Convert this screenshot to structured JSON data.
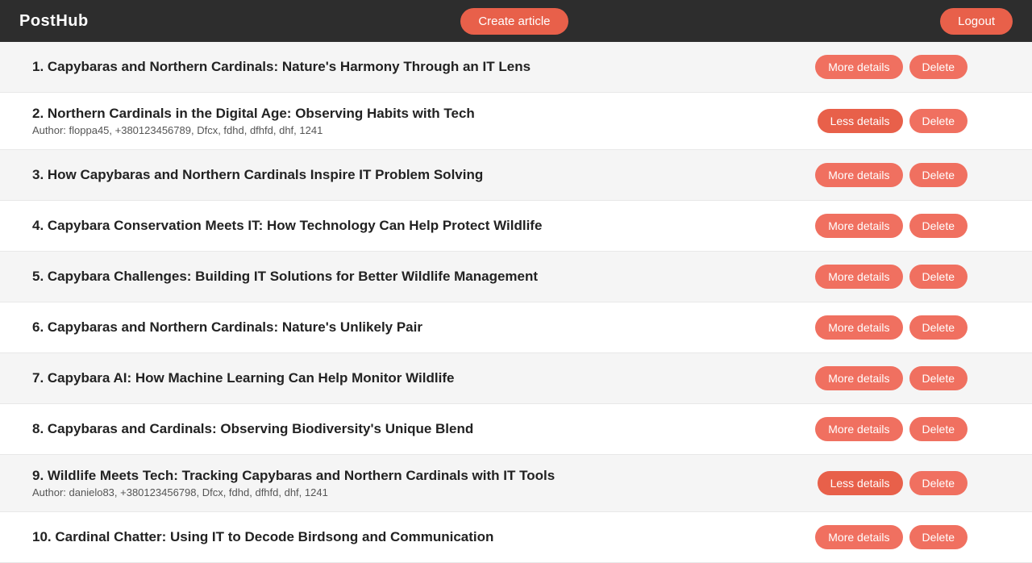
{
  "header": {
    "logo": "PostHub",
    "create_label": "Create article",
    "logout_label": "Logout"
  },
  "articles": [
    {
      "id": 1,
      "title": "1. Capybaras and Northern Cardinals: Nature's Harmony Through an IT Lens",
      "author": null,
      "more_label": "More details",
      "delete_label": "Delete",
      "expanded": false
    },
    {
      "id": 2,
      "title": "2. Northern Cardinals in the Digital Age: Observing Habits with Tech",
      "author": "Author: floppa45, +380123456789, Dfcx, fdhd, dfhfd, dhf, 1241",
      "more_label": "Less details",
      "delete_label": "Delete",
      "expanded": true
    },
    {
      "id": 3,
      "title": "3. How Capybaras and Northern Cardinals Inspire IT Problem Solving",
      "author": null,
      "more_label": "More details",
      "delete_label": "Delete",
      "expanded": false
    },
    {
      "id": 4,
      "title": "4. Capybara Conservation Meets IT: How Technology Can Help Protect Wildlife",
      "author": null,
      "more_label": "More details",
      "delete_label": "Delete",
      "expanded": false
    },
    {
      "id": 5,
      "title": "5. Capybara Challenges: Building IT Solutions for Better Wildlife Management",
      "author": null,
      "more_label": "More details",
      "delete_label": "Delete",
      "expanded": false
    },
    {
      "id": 6,
      "title": "6. Capybaras and Northern Cardinals: Nature's Unlikely Pair",
      "author": null,
      "more_label": "More details",
      "delete_label": "Delete",
      "expanded": false
    },
    {
      "id": 7,
      "title": "7. Capybara AI: How Machine Learning Can Help Monitor Wildlife",
      "author": null,
      "more_label": "More details",
      "delete_label": "Delete",
      "expanded": false
    },
    {
      "id": 8,
      "title": "8. Capybaras and Cardinals: Observing Biodiversity's Unique Blend",
      "author": null,
      "more_label": "More details",
      "delete_label": "Delete",
      "expanded": false
    },
    {
      "id": 9,
      "title": "9. Wildlife Meets Tech: Tracking Capybaras and Northern Cardinals with IT Tools",
      "author": "Author: danielo83, +380123456798, Dfcx, fdhd, dfhfd, dhf, 1241",
      "more_label": "Less details",
      "delete_label": "Delete",
      "expanded": true
    },
    {
      "id": 10,
      "title": "10. Cardinal Chatter: Using IT to Decode Birdsong and Communication",
      "author": null,
      "more_label": "More details",
      "delete_label": "Delete",
      "expanded": false
    }
  ]
}
